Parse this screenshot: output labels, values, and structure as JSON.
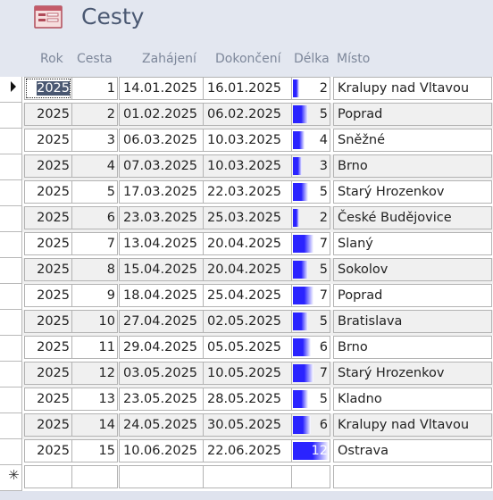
{
  "form": {
    "title": "Cesty",
    "icon": "form-icon"
  },
  "columns": {
    "rok": "Rok",
    "cesta": "Cesta",
    "zahajeni": "Zahájení",
    "dokonceni": "Dokončení",
    "delka": "Délka",
    "misto": "Místo"
  },
  "bar_color": "#2a23ff",
  "bar_max_value": 12,
  "rows": [
    {
      "rok": "2025",
      "cesta": "1",
      "zahajeni": "14.01.2025",
      "dokonceni": "16.01.2025",
      "delka": 2,
      "misto": "Kralupy nad Vltavou"
    },
    {
      "rok": "2025",
      "cesta": "2",
      "zahajeni": "01.02.2025",
      "dokonceni": "06.02.2025",
      "delka": 5,
      "misto": "Poprad"
    },
    {
      "rok": "2025",
      "cesta": "3",
      "zahajeni": "06.03.2025",
      "dokonceni": "10.03.2025",
      "delka": 4,
      "misto": "Sněžné"
    },
    {
      "rok": "2025",
      "cesta": "4",
      "zahajeni": "07.03.2025",
      "dokonceni": "10.03.2025",
      "delka": 3,
      "misto": "Brno"
    },
    {
      "rok": "2025",
      "cesta": "5",
      "zahajeni": "17.03.2025",
      "dokonceni": "22.03.2025",
      "delka": 5,
      "misto": "Starý Hrozenkov"
    },
    {
      "rok": "2025",
      "cesta": "6",
      "zahajeni": "23.03.2025",
      "dokonceni": "25.03.2025",
      "delka": 2,
      "misto": "České Budějovice"
    },
    {
      "rok": "2025",
      "cesta": "7",
      "zahajeni": "13.04.2025",
      "dokonceni": "20.04.2025",
      "delka": 7,
      "misto": "Slaný"
    },
    {
      "rok": "2025",
      "cesta": "8",
      "zahajeni": "15.04.2025",
      "dokonceni": "20.04.2025",
      "delka": 5,
      "misto": "Sokolov"
    },
    {
      "rok": "2025",
      "cesta": "9",
      "zahajeni": "18.04.2025",
      "dokonceni": "25.04.2025",
      "delka": 7,
      "misto": "Poprad"
    },
    {
      "rok": "2025",
      "cesta": "10",
      "zahajeni": "27.04.2025",
      "dokonceni": "02.05.2025",
      "delka": 5,
      "misto": "Bratislava"
    },
    {
      "rok": "2025",
      "cesta": "11",
      "zahajeni": "29.04.2025",
      "dokonceni": "05.05.2025",
      "delka": 6,
      "misto": "Brno"
    },
    {
      "rok": "2025",
      "cesta": "12",
      "zahajeni": "03.05.2025",
      "dokonceni": "10.05.2025",
      "delka": 7,
      "misto": "Starý Hrozenkov"
    },
    {
      "rok": "2025",
      "cesta": "13",
      "zahajeni": "23.05.2025",
      "dokonceni": "28.05.2025",
      "delka": 5,
      "misto": "Kladno"
    },
    {
      "rok": "2025",
      "cesta": "14",
      "zahajeni": "24.05.2025",
      "dokonceni": "30.05.2025",
      "delka": 6,
      "misto": "Kralupy nad Vltavou"
    },
    {
      "rok": "2025",
      "cesta": "15",
      "zahajeni": "10.06.2025",
      "dokonceni": "22.06.2025",
      "delka": 12,
      "misto": "Ostrava"
    }
  ]
}
